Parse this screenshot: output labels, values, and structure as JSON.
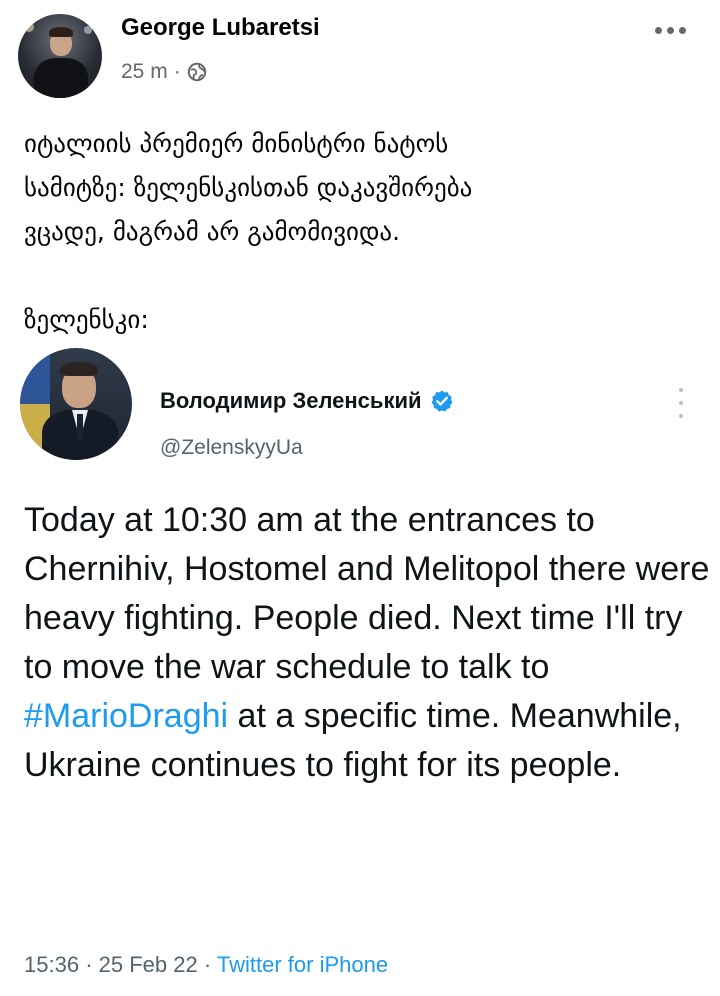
{
  "post": {
    "author": "George Lubaretsi",
    "time": "25 m",
    "separator": "·",
    "text_lines": [
      "იტალიის პრემიერ მინისტრი ნატოს",
      "სამიტზე: ზელენსკისთან დაკავშირება",
      "ვცადე, მაგრამ არ გამომივიდა."
    ],
    "text_label": "ზელენსკი:"
  },
  "tweet": {
    "name": "Володимир Зеленський",
    "handle": "@ZelenskyyUa",
    "text_before": "Today at 10:30 am at the entrances to Chernihiv, Hostomel and Melitopol there were heavy fighting. People died. Next time I'll try to move the war schedule to talk to ",
    "hashtag": "#MarioDraghi",
    "text_after": " at a specific time. Meanwhile, Ukraine continues to fight for its people.",
    "time": "15:36",
    "date": "25 Feb 22",
    "separator": "·",
    "source": "Twitter for iPhone"
  },
  "colors": {
    "link_blue": "#1d9bf0",
    "meta_gray": "#65676b",
    "verified_blue": "#1d9bf0"
  },
  "icons": {
    "privacy": "globe-icon",
    "post_menu": "more-horizontal-icon",
    "tweet_menu": "more-vertical-icon",
    "badge": "verified-icon"
  }
}
